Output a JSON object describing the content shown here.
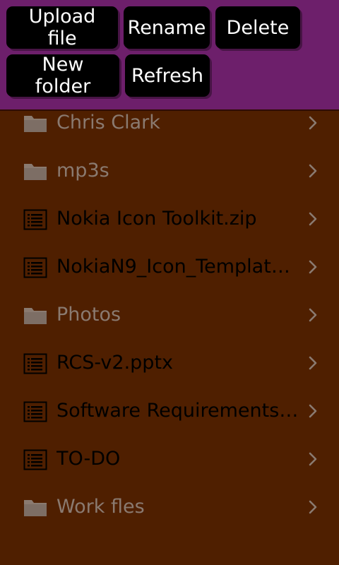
{
  "toolbar": {
    "upload_label": "Upload file",
    "rename_label": "Rename",
    "delete_label": "Delete",
    "new_folder_label": "New folder",
    "refresh_label": "Refresh"
  },
  "files": [
    {
      "name": "Chris Clark",
      "type": "folder",
      "icon": "folder-icon"
    },
    {
      "name": "mp3s",
      "type": "folder",
      "icon": "folder-icon"
    },
    {
      "name": "Nokia Icon Toolkit.zip",
      "type": "file",
      "icon": "document-icon"
    },
    {
      "name": "NokiaN9_Icon_Templates....",
      "type": "file",
      "icon": "document-icon"
    },
    {
      "name": "Photos",
      "type": "folder",
      "icon": "folder-icon"
    },
    {
      "name": "RCS-v2.pptx",
      "type": "file",
      "icon": "document-icon"
    },
    {
      "name": "Software Requirements S...",
      "type": "file",
      "icon": "document-icon"
    },
    {
      "name": "TO-DO",
      "type": "file",
      "icon": "document-icon"
    },
    {
      "name": "Work fles",
      "type": "folder",
      "icon": "folder-icon"
    }
  ],
  "colors": {
    "toolbar_bg": "#6d1f6b",
    "list_bg": "#4f1f00",
    "button_bg": "#000000",
    "folder_text": "#8a7a70",
    "file_text": "#000000"
  }
}
